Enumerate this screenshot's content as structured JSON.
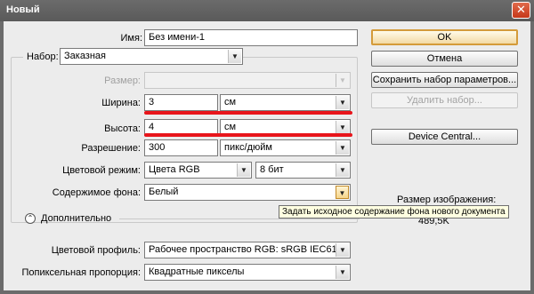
{
  "window": {
    "title": "Новый",
    "close_glyph": "✕"
  },
  "name_label": "Имя:",
  "name_value": "Без имени-1",
  "preset_label": "Набор:",
  "preset_value": "Заказная",
  "size_label": "Размер:",
  "size_value": "",
  "width_label": "Ширина:",
  "width_value": "3",
  "width_unit": "см",
  "height_label": "Высота:",
  "height_value": "4",
  "height_unit": "см",
  "resolution_label": "Разрешение:",
  "resolution_value": "300",
  "resolution_unit": "пикс/дюйм",
  "color_mode_label": "Цветовой режим:",
  "color_mode_value": "Цвета RGB",
  "bit_depth_value": "8 бит",
  "background_label": "Содержимое фона:",
  "background_value": "Белый",
  "advanced_label": "Дополнительно",
  "advanced_glyph": "⌃",
  "color_profile_label": "Цветовой профиль:",
  "color_profile_value": "Рабочее пространство RGB:  sRGB IEC61...",
  "pixel_aspect_label": "Попиксельная пропорция:",
  "pixel_aspect_value": "Квадратные пикселы",
  "buttons": {
    "ok": "OK",
    "cancel": "Отмена",
    "save_preset": "Сохранить набор параметров...",
    "delete_preset": "Удалить набор...",
    "device_central": "Device Central..."
  },
  "image_size_label": "Размер изображения:",
  "image_size_value": "489,5K",
  "tooltip": "Задать исходное содержание фона нового документа",
  "dropdown_glyph": "▼",
  "colors": {
    "highlight_red": "#e8151b",
    "default_button": "#d49b3a",
    "title_bg": "#6b6b6b"
  }
}
